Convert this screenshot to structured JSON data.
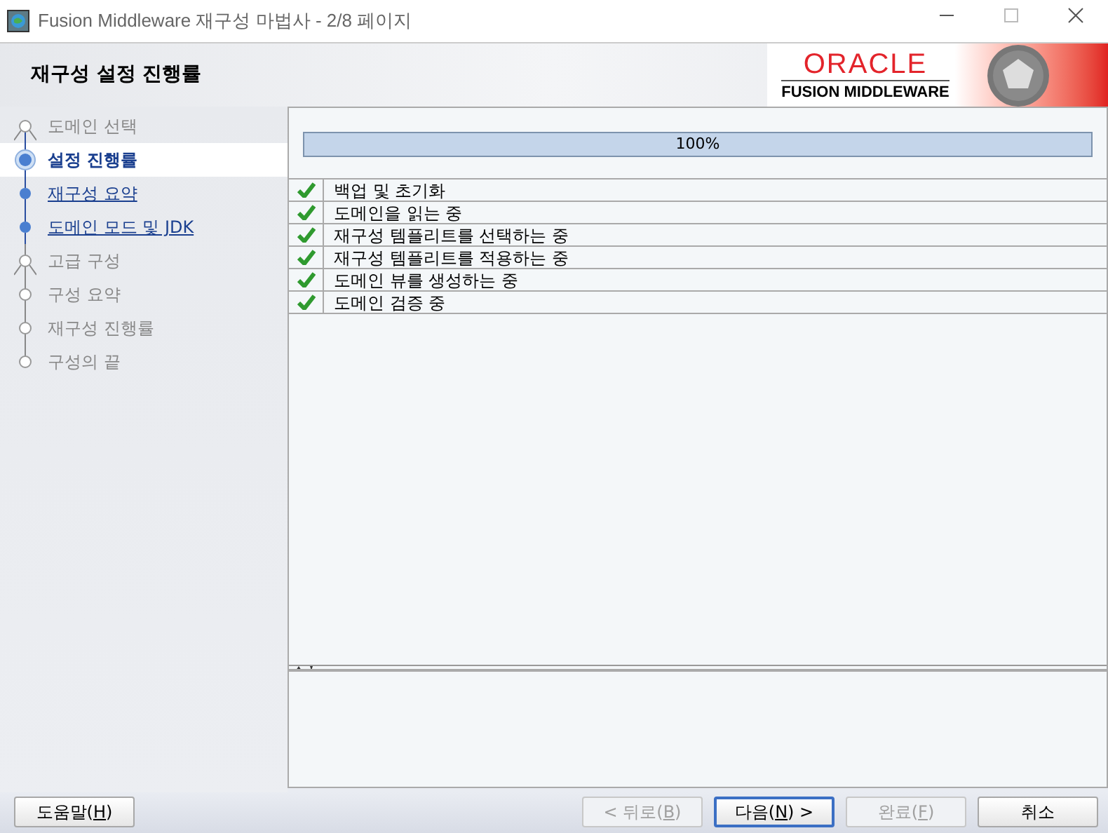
{
  "window": {
    "title": "Fusion Middleware 재구성 마법사 - 2/8 페이지"
  },
  "header": {
    "title": "재구성 설정 진행률",
    "logo_top": "ORACLE",
    "logo_bottom": "FUSION MIDDLEWARE"
  },
  "steps": [
    {
      "label": "도메인 선택",
      "kind": "visited",
      "branch": true,
      "selected": false
    },
    {
      "label": "설정 진행률",
      "kind": "current",
      "branch": false,
      "selected": true
    },
    {
      "label": "재구성 요약",
      "kind": "available",
      "branch": false,
      "selected": false
    },
    {
      "label": "도메인 모드 및 JDK",
      "kind": "available",
      "branch": false,
      "selected": false
    },
    {
      "label": "고급 구성",
      "kind": "upcoming",
      "branch": true,
      "selected": false
    },
    {
      "label": "구성 요약",
      "kind": "upcoming",
      "branch": false,
      "selected": false
    },
    {
      "label": "재구성 진행률",
      "kind": "upcoming",
      "branch": false,
      "selected": false
    },
    {
      "label": "구성의 끝",
      "kind": "upcoming",
      "branch": false,
      "selected": false
    }
  ],
  "progress": {
    "level": 1,
    "reading": "100%"
  },
  "tasks": [
    {
      "label": "백업 및 초기화",
      "done": true
    },
    {
      "label": "도메인을 읽는 중",
      "done": true
    },
    {
      "label": "재구성 템플리트를 선택하는 중",
      "done": true
    },
    {
      "label": "재구성 템플리트를 적용하는 중",
      "done": true
    },
    {
      "label": "도메인 뷰를 생성하는 중",
      "done": true
    },
    {
      "label": "도메인 검증 중",
      "done": true
    }
  ],
  "buttons": [
    {
      "kind": "help",
      "parts": [
        "도움말(",
        "H",
        ")"
      ],
      "disabled": false,
      "default": false
    },
    {
      "kind": "nav",
      "parts": [
        "< 뒤로(",
        "B",
        ")"
      ],
      "disabled": true,
      "default": false
    },
    {
      "kind": "nav",
      "parts": [
        "다음(",
        "N",
        ") >"
      ],
      "disabled": false,
      "default": true
    },
    {
      "kind": "nav",
      "parts": [
        "완료(",
        "F",
        ")"
      ],
      "disabled": true,
      "default": false
    },
    {
      "kind": "nav",
      "parts": [
        "취소"
      ],
      "disabled": false,
      "default": false
    }
  ]
}
